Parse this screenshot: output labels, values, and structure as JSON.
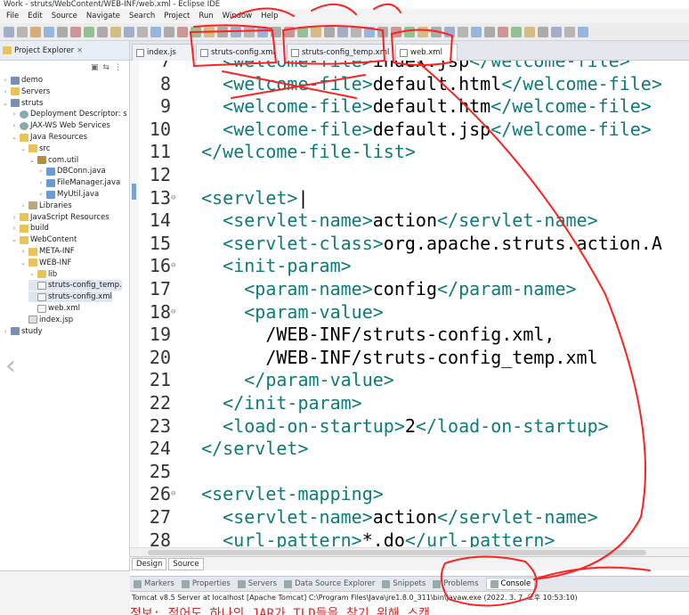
{
  "window": {
    "title": "Work - struts/WebContent/WEB-INF/web.xml - Eclipse IDE"
  },
  "menu": [
    "File",
    "Edit",
    "Source",
    "Navigate",
    "Search",
    "Project",
    "Run",
    "Window",
    "Help"
  ],
  "explorer": {
    "title": "Project Explorer",
    "tree": [
      {
        "label": "demo",
        "depth": 0,
        "twisty": "›",
        "icon": "proj"
      },
      {
        "label": "Servers",
        "depth": 0,
        "twisty": "›",
        "icon": "folder"
      },
      {
        "label": "struts",
        "depth": 0,
        "twisty": "⌄",
        "icon": "proj"
      },
      {
        "label": "Deployment Descriptor: s",
        "depth": 1,
        "twisty": "›",
        "icon": "gear"
      },
      {
        "label": "JAX-WS Web Services",
        "depth": 1,
        "twisty": "›",
        "icon": "gear"
      },
      {
        "label": "Java Resources",
        "depth": 1,
        "twisty": "⌄",
        "icon": "folder"
      },
      {
        "label": "src",
        "depth": 2,
        "twisty": "⌄",
        "icon": "folder"
      },
      {
        "label": "com.util",
        "depth": 3,
        "twisty": "⌄",
        "icon": "pkg"
      },
      {
        "label": "DBConn.java",
        "depth": 4,
        "twisty": "›",
        "icon": "java"
      },
      {
        "label": "FileManager.java",
        "depth": 4,
        "twisty": "›",
        "icon": "java"
      },
      {
        "label": "MyUtil.java",
        "depth": 4,
        "twisty": "›",
        "icon": "java"
      },
      {
        "label": "Libraries",
        "depth": 2,
        "twisty": "›",
        "icon": "lib"
      },
      {
        "label": "JavaScript Resources",
        "depth": 1,
        "twisty": "›",
        "icon": "folder"
      },
      {
        "label": "build",
        "depth": 1,
        "twisty": "›",
        "icon": "folder"
      },
      {
        "label": "WebContent",
        "depth": 1,
        "twisty": "⌄",
        "icon": "folder"
      },
      {
        "label": "META-INF",
        "depth": 2,
        "twisty": "›",
        "icon": "folder"
      },
      {
        "label": "WEB-INF",
        "depth": 2,
        "twisty": "⌄",
        "icon": "folder"
      },
      {
        "label": "lib",
        "depth": 3,
        "twisty": "›",
        "icon": "folder"
      },
      {
        "label": "struts-config_temp.",
        "depth": 3,
        "twisty": "",
        "icon": "xml",
        "selected": true
      },
      {
        "label": "struts-config.xml",
        "depth": 3,
        "twisty": "",
        "icon": "xml",
        "selected": true
      },
      {
        "label": "web.xml",
        "depth": 3,
        "twisty": "",
        "icon": "xml"
      },
      {
        "label": "index.jsp",
        "depth": 2,
        "twisty": "",
        "icon": "jsp"
      },
      {
        "label": "study",
        "depth": 0,
        "twisty": "›",
        "icon": "proj"
      }
    ]
  },
  "editor_tabs": [
    {
      "label": "index.js",
      "active": false
    },
    {
      "label": "struts-config.xml",
      "active": false
    },
    {
      "label": "struts-config_temp.xml",
      "active": false
    },
    {
      "label": "web.xml",
      "active": true
    }
  ],
  "code": [
    {
      "n": "7",
      "fold": "",
      "text": "    <welcome-file>index.jsp</welcome-file>"
    },
    {
      "n": "8",
      "fold": "",
      "text": "    <welcome-file>default.html</welcome-file>"
    },
    {
      "n": "9",
      "fold": "",
      "text": "    <welcome-file>default.htm</welcome-file>"
    },
    {
      "n": "10",
      "fold": "",
      "text": "    <welcome-file>default.jsp</welcome-file>"
    },
    {
      "n": "11",
      "fold": "",
      "text": "  </welcome-file-list>"
    },
    {
      "n": "12",
      "fold": "",
      "text": ""
    },
    {
      "n": "13",
      "fold": "⊖",
      "text": "  <servlet>|"
    },
    {
      "n": "14",
      "fold": "",
      "text": "    <servlet-name>action</servlet-name>"
    },
    {
      "n": "15",
      "fold": "",
      "text": "    <servlet-class>org.apache.struts.action.A"
    },
    {
      "n": "16",
      "fold": "⊖",
      "text": "    <init-param>"
    },
    {
      "n": "17",
      "fold": "",
      "text": "      <param-name>config</param-name>"
    },
    {
      "n": "18",
      "fold": "⊖",
      "text": "      <param-value>"
    },
    {
      "n": "19",
      "fold": "",
      "text": "        /WEB-INF/struts-config.xml,"
    },
    {
      "n": "20",
      "fold": "",
      "text": "        /WEB-INF/struts-config_temp.xml"
    },
    {
      "n": "21",
      "fold": "",
      "text": "      </param-value>"
    },
    {
      "n": "22",
      "fold": "",
      "text": "    </init-param>"
    },
    {
      "n": "23",
      "fold": "",
      "text": "    <load-on-startup>2</load-on-startup>"
    },
    {
      "n": "24",
      "fold": "",
      "text": "  </servlet>"
    },
    {
      "n": "25",
      "fold": "",
      "text": ""
    },
    {
      "n": "26",
      "fold": "⊖",
      "text": "  <servlet-mapping>"
    },
    {
      "n": "27",
      "fold": "",
      "text": "    <servlet-name>action</servlet-name>"
    },
    {
      "n": "28",
      "fold": "",
      "text": "    <url-pattern>*.do</url-pattern>"
    }
  ],
  "design_tabs": {
    "design": "Design",
    "source": "Source"
  },
  "bottom_tabs": [
    {
      "label": "Markers",
      "active": false
    },
    {
      "label": "Properties",
      "active": false
    },
    {
      "label": "Servers",
      "active": false
    },
    {
      "label": "Data Source Explorer",
      "active": false
    },
    {
      "label": "Snippets",
      "active": false
    },
    {
      "label": "Problems",
      "active": false
    },
    {
      "label": "Console",
      "active": true
    }
  ],
  "console": {
    "header": "Tomcat v8.5 Server at localhost [Apache Tomcat] C:\\Program Files\\Java\\jre1.8.0_311\\bin\\javaw.exe (2022. 3. 7. 오후 10:53:10)",
    "line": "정보: 적어도 하나의 JAR가 TLD들을 찾기 위해 스캔"
  },
  "colors": {
    "tag": "#0e7a7a",
    "text": "#000000",
    "annotation": "#ff2020"
  }
}
